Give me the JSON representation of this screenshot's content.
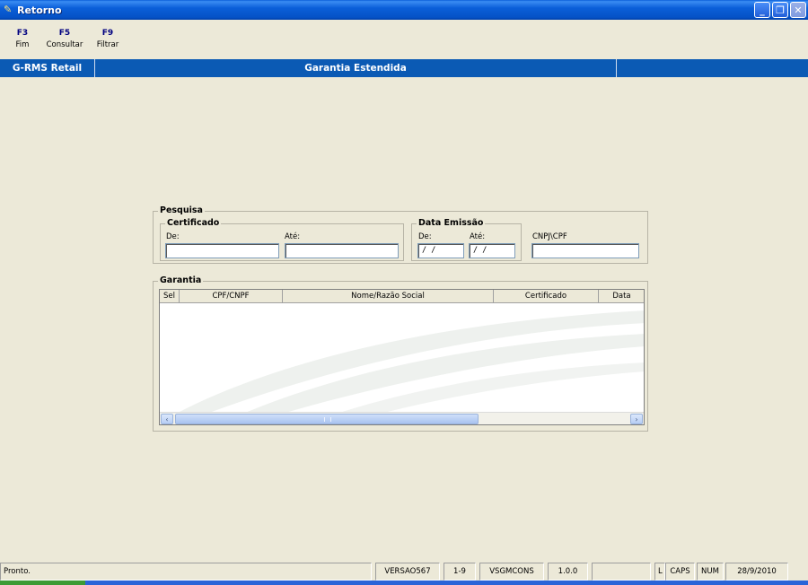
{
  "window": {
    "title": "Retorno",
    "buttons": {
      "minimize": "_",
      "restore": "❐",
      "close": "✕"
    }
  },
  "toolbar": {
    "items": [
      {
        "key": "F3",
        "label": "Fim"
      },
      {
        "key": "F5",
        "label": "Consultar"
      },
      {
        "key": "F9",
        "label": "Filtrar"
      }
    ]
  },
  "header": {
    "app_name": "G-RMS Retail",
    "screen_title": "Garantia Estendida"
  },
  "search": {
    "title": "Pesquisa",
    "certificado": {
      "title": "Certificado",
      "from_label": "De:",
      "from_value": "",
      "to_label": "Até:",
      "to_value": ""
    },
    "data_emissao": {
      "title": "Data Emissão",
      "from_label": "De:",
      "from_value": " / /",
      "to_label": "Até:",
      "to_value": " / /"
    },
    "cnpj_cpf": {
      "label": "CNPJ\\CPF",
      "value": ""
    }
  },
  "garantia": {
    "title": "Garantia",
    "columns": [
      "Sel",
      "CPF/CNPF",
      "Nome/Razão Social",
      "Certificado",
      "Data"
    ],
    "rows": [],
    "scroll": {
      "left_arrow": "‹",
      "right_arrow": "›"
    }
  },
  "statusbar": {
    "message": "Pronto.",
    "version": "VERSAO567",
    "range": "1-9",
    "program": "VSGMCONS",
    "build": "1.0.0",
    "blank": "",
    "l": "L",
    "caps": "CAPS",
    "num": "NUM",
    "date": "28/9/2010"
  },
  "colors": {
    "titlebar": "#0b5fd9",
    "header_band": "#0b5ab4",
    "background": "#ece9d8",
    "toolbar_key": "#000080"
  }
}
